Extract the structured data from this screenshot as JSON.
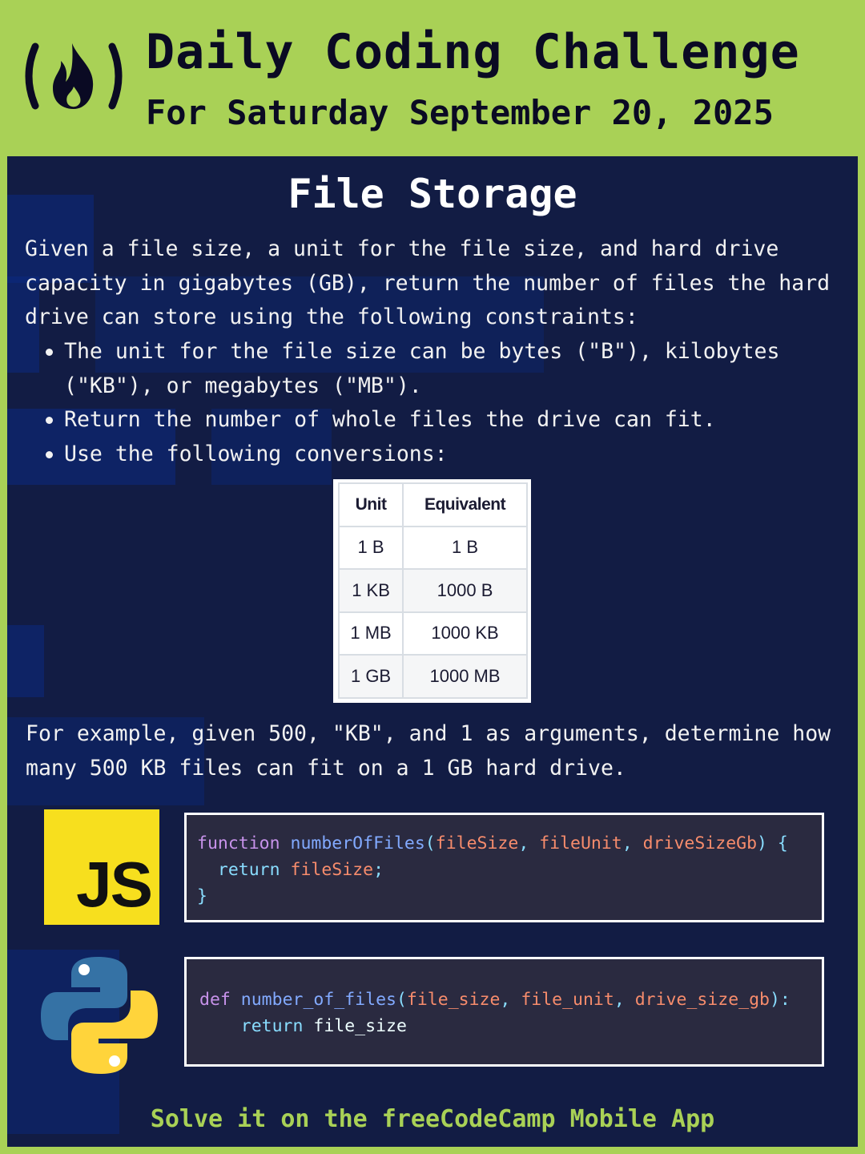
{
  "header": {
    "title": "Daily Coding Challenge",
    "subtitle": "For Saturday September 20, 2025"
  },
  "challenge": {
    "title": "File Storage",
    "description": "Given a file size, a unit for the file size, and hard drive capacity in gigabytes (GB), return the number of files the hard drive can store using the following constraints:",
    "bullets": [
      "The unit for the file size can be bytes (\"B\"), kilobytes (\"KB\"), or megabytes (\"MB\").",
      "Return the number of whole files the drive can fit.",
      "Use the following conversions:"
    ],
    "conversion_table": {
      "headers": [
        "Unit",
        "Equivalent"
      ],
      "rows": [
        [
          "1 B",
          "1 B"
        ],
        [
          "1 KB",
          "1000 B"
        ],
        [
          "1 MB",
          "1000 KB"
        ],
        [
          "1 GB",
          "1000 MB"
        ]
      ]
    },
    "example": "For example, given 500, \"KB\", and 1 as arguments, determine how many 500 KB files can fit on a 1 GB hard drive."
  },
  "javascript": {
    "logo_text": "JS",
    "keyword": "function",
    "fn_name": "numberOfFiles",
    "param1": "fileSize",
    "param2": "fileUnit",
    "param3": "driveSizeGb",
    "return_kw": "return",
    "return_val": "fileSize"
  },
  "python": {
    "keyword": "def",
    "fn_name": "number_of_files",
    "param1": "file_size",
    "param2": "file_unit",
    "param3": "drive_size_gb",
    "return_kw": "return",
    "return_val": "file_size"
  },
  "footer": "Solve it on the freeCodeCamp Mobile App",
  "colors": {
    "brand_green": "#a9d156",
    "panel_navy": "#121c44",
    "js_yellow": "#f7df1e",
    "python_blue": "#3572a5",
    "python_yellow": "#ffd43b"
  },
  "icons": {
    "brand": "freecodecamp-flame-icon",
    "js": "javascript-logo",
    "python": "python-logo"
  }
}
